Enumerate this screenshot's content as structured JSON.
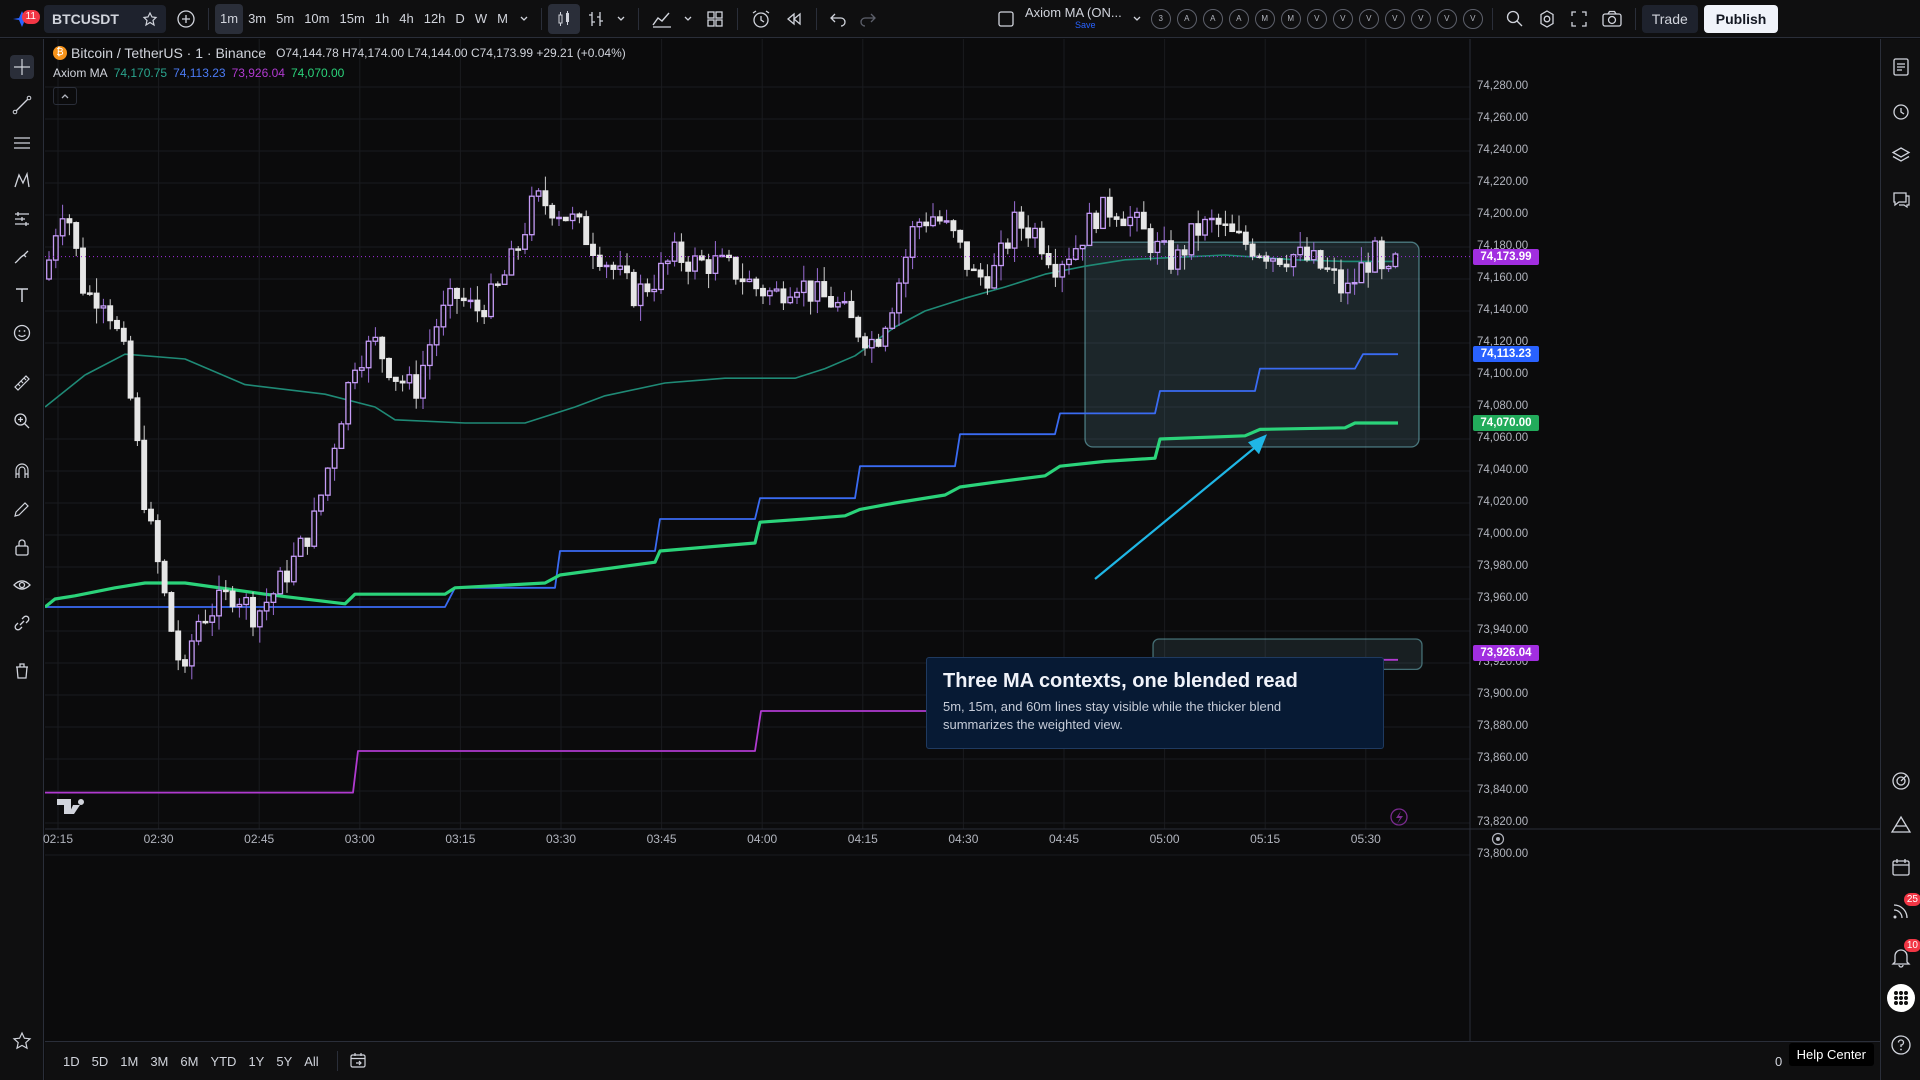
{
  "topbar": {
    "notification_count": "11",
    "symbol": "BTCUSDT",
    "intervals": [
      "1m",
      "3m",
      "5m",
      "10m",
      "15m",
      "1h",
      "4h",
      "12h",
      "D",
      "W",
      "M"
    ],
    "active_interval": "1m",
    "indicator_name": "Axiom MA (ON...",
    "indicator_save": "Save",
    "indicator_params": [
      "3",
      "A",
      "A",
      "A",
      "M",
      "M",
      "V",
      "V",
      "V",
      "V",
      "V",
      "V",
      "V"
    ],
    "trade_label": "Trade",
    "publish_label": "Publish"
  },
  "legend": {
    "title": "Bitcoin / TetherUS · 1 · Binance",
    "open": "O74,144.78",
    "high": "H74,174.00",
    "low": "L74,144.00",
    "close": "C74,173.99",
    "change": "+29.21 (+0.04%)",
    "indicator": "Axiom MA",
    "values": [
      "74,170.75",
      "74,113.23",
      "73,926.04",
      "74,070.00"
    ]
  },
  "colors": {
    "up": "#c59cf6",
    "down": "#e6e6e6",
    "ma_teal": "#1f8a76",
    "ma_blue": "#3a6bf2",
    "ma_green": "#2bd37a",
    "ma_magenta": "#b03ad0",
    "tag_close": "#a12ee0",
    "tag_blue": "#2962ff",
    "tag_green": "#22ab5b",
    "tag_magenta": "#a12ee0",
    "arrow": "#1fb7e6"
  },
  "price_axis": {
    "labels": [
      "74,280.00",
      "74,260.00",
      "74,240.00",
      "74,220.00",
      "74,200.00",
      "74,180.00",
      "74,160.00",
      "74,140.00",
      "74,120.00",
      "74,100.00",
      "74,080.00",
      "74,060.00",
      "74,040.00",
      "74,020.00",
      "74,000.00",
      "73,980.00",
      "73,960.00",
      "73,940.00",
      "73,920.00",
      "73,900.00",
      "73,880.00",
      "73,860.00",
      "73,840.00",
      "73,820.00",
      "73,800.00"
    ],
    "tags": {
      "close": "74,173.99",
      "blue": "74,113.23",
      "green": "74,070.00",
      "magenta": "73,926.04"
    }
  },
  "time_axis": [
    "02:15",
    "02:30",
    "02:45",
    "03:00",
    "03:15",
    "03:30",
    "03:45",
    "04:00",
    "04:15",
    "04:30",
    "04:45",
    "05:00",
    "05:15",
    "05:30"
  ],
  "annotation": {
    "title": "Three MA contexts, one blended read",
    "desc_line1": "5m, 15m, and 60m lines stay visible while the thicker blend",
    "desc_line2": "summarizes the weighted view."
  },
  "bottombar": {
    "ranges": [
      "1D",
      "5D",
      "1M",
      "3M",
      "6M",
      "YTD",
      "1Y",
      "5Y",
      "All"
    ],
    "zero": "0",
    "help": "Help Center"
  },
  "rightbar": {
    "badge_feed": "25",
    "badge_alerts": "10"
  },
  "chart_data": {
    "type": "candlestick",
    "y_range": [
      73800,
      74280
    ],
    "x_range": [
      "02:15",
      "05:30"
    ],
    "ma_lines": [
      {
        "name": "Axiom MA",
        "value": 74170.75
      },
      {
        "name": "Axiom MA",
        "value": 74113.23
      },
      {
        "name": "Axiom MA",
        "value": 73926.04
      },
      {
        "name": "Axiom MA",
        "value": 74070.0
      }
    ],
    "ma_blue": [
      [
        0,
        73955
      ],
      [
        50,
        73955
      ],
      [
        100,
        73955
      ],
      [
        150,
        73955
      ],
      [
        220,
        73955
      ],
      [
        300,
        73955
      ],
      [
        400,
        73955
      ],
      [
        410,
        73967
      ],
      [
        510,
        73967
      ],
      [
        515,
        73990
      ],
      [
        610,
        73990
      ],
      [
        615,
        74010
      ],
      [
        710,
        74010
      ],
      [
        715,
        74023
      ],
      [
        810,
        74023
      ],
      [
        815,
        74043
      ],
      [
        910,
        74043
      ],
      [
        915,
        74063
      ],
      [
        1010,
        74063
      ],
      [
        1015,
        74076
      ],
      [
        1110,
        74076
      ],
      [
        1115,
        74090
      ],
      [
        1210,
        74090
      ],
      [
        1215,
        74104
      ],
      [
        1310,
        74104
      ],
      [
        1318,
        74113
      ],
      [
        1353,
        74113
      ]
    ],
    "ma_green": [
      [
        0,
        73955
      ],
      [
        10,
        73960
      ],
      [
        30,
        73962
      ],
      [
        70,
        73967
      ],
      [
        100,
        73970
      ],
      [
        140,
        73970
      ],
      [
        220,
        73963
      ],
      [
        300,
        73957
      ],
      [
        310,
        73963
      ],
      [
        400,
        73963
      ],
      [
        410,
        73967
      ],
      [
        500,
        73970
      ],
      [
        515,
        73975
      ],
      [
        610,
        73983
      ],
      [
        615,
        73990
      ],
      [
        710,
        73995
      ],
      [
        715,
        74008
      ],
      [
        760,
        74010
      ],
      [
        800,
        74012
      ],
      [
        815,
        74016
      ],
      [
        850,
        74020
      ],
      [
        900,
        74025
      ],
      [
        915,
        74030
      ],
      [
        950,
        74033
      ],
      [
        1000,
        74037
      ],
      [
        1015,
        74043
      ],
      [
        1060,
        74046
      ],
      [
        1110,
        74048
      ],
      [
        1115,
        74060
      ],
      [
        1200,
        74062
      ],
      [
        1215,
        74066
      ],
      [
        1300,
        74067
      ],
      [
        1310,
        74070
      ],
      [
        1353,
        74070
      ]
    ],
    "ma_magenta": [
      [
        0,
        73839
      ],
      [
        308,
        73839
      ],
      [
        313,
        73865
      ],
      [
        710,
        73865
      ],
      [
        716,
        73890
      ],
      [
        1113,
        73890
      ],
      [
        1118,
        73922
      ],
      [
        1353,
        73922
      ]
    ],
    "ma_teal": [
      [
        0,
        74080
      ],
      [
        40,
        74100
      ],
      [
        80,
        74113
      ],
      [
        140,
        74110
      ],
      [
        200,
        74094
      ],
      [
        280,
        74088
      ],
      [
        330,
        74080
      ],
      [
        350,
        74072
      ],
      [
        420,
        74070
      ],
      [
        480,
        74070
      ],
      [
        530,
        74080
      ],
      [
        560,
        74087
      ],
      [
        620,
        74095
      ],
      [
        680,
        74098
      ],
      [
        750,
        74098
      ],
      [
        780,
        74104
      ],
      [
        810,
        74112
      ],
      [
        850,
        74130
      ],
      [
        880,
        74140
      ],
      [
        920,
        74148
      ],
      [
        960,
        74155
      ],
      [
        1000,
        74163
      ],
      [
        1040,
        74168
      ],
      [
        1080,
        74172
      ],
      [
        1180,
        74175
      ],
      [
        1250,
        74172
      ],
      [
        1300,
        74171
      ],
      [
        1353,
        74171
      ]
    ],
    "candles_hint": "1-minute BTCUSDT candles between 73,890 and 74,245"
  }
}
